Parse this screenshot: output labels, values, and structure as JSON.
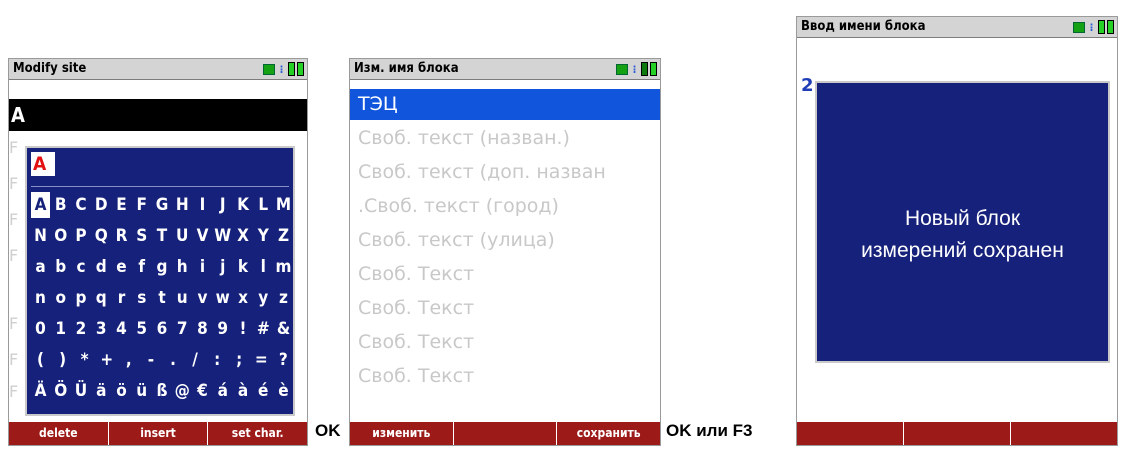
{
  "screens": {
    "modify_site": {
      "title": "Modify site",
      "entry_value": "A",
      "ghost_rows": [
        "F",
        "F",
        "F",
        "F",
        "F",
        "F",
        "F"
      ],
      "keyboard": {
        "current": "A",
        "rows": [
          [
            "A",
            "B",
            "C",
            "D",
            "E",
            "F",
            "G",
            "H",
            "I",
            "J",
            "K",
            "L",
            "M"
          ],
          [
            "N",
            "O",
            "P",
            "Q",
            "R",
            "S",
            "T",
            "U",
            "V",
            "W",
            "X",
            "Y",
            "Z"
          ],
          [
            "a",
            "b",
            "c",
            "d",
            "e",
            "f",
            "g",
            "h",
            "i",
            "j",
            "k",
            "l",
            "m"
          ],
          [
            "n",
            "o",
            "p",
            "q",
            "r",
            "s",
            "t",
            "u",
            "v",
            "w",
            "x",
            "y",
            "z"
          ],
          [
            "0",
            "1",
            "2",
            "3",
            "4",
            "5",
            "6",
            "7",
            "8",
            "9",
            "!",
            "#",
            "&"
          ],
          [
            "(",
            ")",
            "*",
            "+",
            ",",
            "-",
            ".",
            "/",
            ":",
            ";",
            "=",
            "?"
          ],
          [
            "Ä",
            "Ö",
            "Ü",
            "ä",
            "ö",
            "ü",
            "ß",
            "@",
            "€",
            "á",
            "à",
            "é",
            "è"
          ]
        ],
        "selected_key": "A"
      },
      "softkeys": [
        "delete",
        "insert",
        "set char."
      ]
    },
    "rename_block": {
      "title": "Изм. имя блока",
      "items": [
        "ТЭЦ",
        "Своб. текст (назван.)",
        "Своб. текст (доп. назван",
        ".Своб. текст (город)",
        "Своб. текст (улица)",
        "Своб. Текст",
        "Своб. Текст",
        "Своб. Текст",
        "Своб. Текст"
      ],
      "selected_index": 0,
      "softkeys": [
        "изменить",
        "",
        "сохранить"
      ]
    },
    "enter_block_name": {
      "title": "Ввод имени блока",
      "hint_char": "2",
      "message_line1": "Новый блок",
      "message_line2": "измерений сохранен",
      "softkeys": [
        "",
        "",
        ""
      ]
    }
  },
  "transitions": {
    "first": "OK",
    "second": "OK или F3"
  },
  "colors": {
    "softkey_bar": "#9c1a18",
    "dialog_bg": "#15217a",
    "selection": "#1155dd"
  },
  "icons": [
    "network-icon",
    "signal-icon",
    "battery-icon"
  ]
}
